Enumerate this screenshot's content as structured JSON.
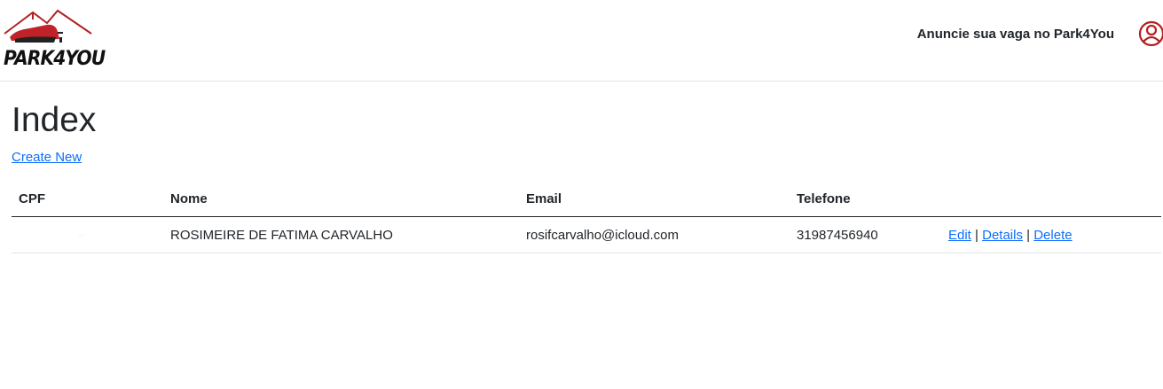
{
  "navbar": {
    "brand": "PARK4YOU",
    "advertise_link": "Anuncie sua vaga no Park4You",
    "user_icon": "user-circle-icon",
    "accent_color": "#b22222"
  },
  "page": {
    "title": "Index",
    "create_new": "Create New"
  },
  "table": {
    "headers": [
      "CPF",
      "Nome",
      "Email",
      "Telefone"
    ],
    "rows": [
      {
        "cpf": "...",
        "nome": "ROSIMEIRE DE FATIMA CARVALHO",
        "email": "rosifcarvalho@icloud.com",
        "telefone": "31987456940",
        "actions": [
          "Edit",
          "Details",
          "Delete"
        ]
      }
    ]
  }
}
